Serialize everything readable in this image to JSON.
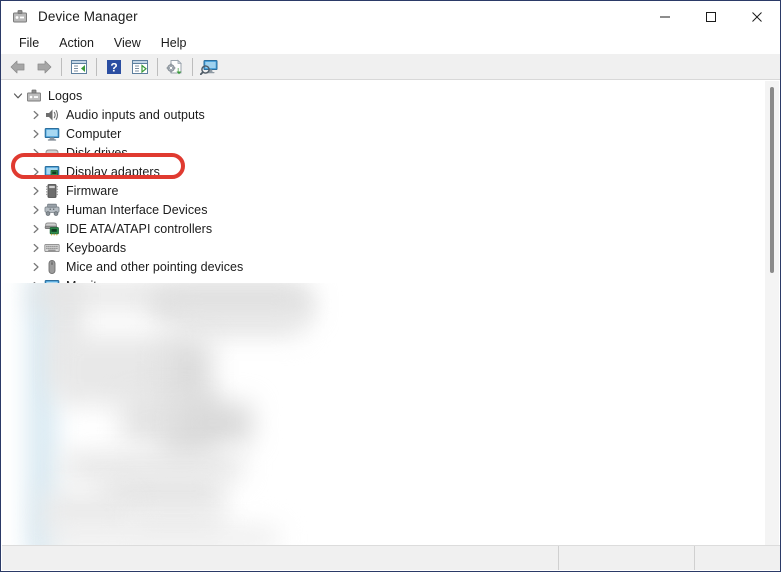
{
  "window": {
    "title": "Device Manager",
    "app_icon": "device-manager-icon",
    "controls": {
      "minimize": "minimize-icon",
      "maximize": "maximize-icon",
      "close": "close-icon"
    }
  },
  "menubar": {
    "items": [
      {
        "label": "File"
      },
      {
        "label": "Action"
      },
      {
        "label": "View"
      },
      {
        "label": "Help"
      }
    ]
  },
  "toolbar": {
    "buttons": [
      {
        "name": "back-arrow-icon",
        "tooltip": "Back",
        "enabled": false
      },
      {
        "name": "forward-arrow-icon",
        "tooltip": "Forward",
        "enabled": false
      },
      {
        "name": "show-hide-console-tree-icon",
        "tooltip": "Show/Hide Console Tree",
        "enabled": true
      },
      {
        "name": "help-icon",
        "tooltip": "Help",
        "enabled": true
      },
      {
        "name": "properties-icon",
        "tooltip": "Properties",
        "enabled": true
      },
      {
        "name": "update-driver-icon",
        "tooltip": "Update driver",
        "enabled": true
      },
      {
        "name": "scan-for-hardware-changes-icon",
        "tooltip": "Scan for hardware changes",
        "enabled": true
      }
    ]
  },
  "tree": {
    "root": {
      "label": "Logos",
      "icon": "computer-root-icon",
      "expanded": true,
      "depth": 0
    },
    "items": [
      {
        "label": "Audio inputs and outputs",
        "icon": "speaker-icon",
        "expanded": false,
        "depth": 1,
        "highlighted": false
      },
      {
        "label": "Computer",
        "icon": "monitor-icon",
        "expanded": false,
        "depth": 1,
        "highlighted": false
      },
      {
        "label": "Disk drives",
        "icon": "disk-drive-icon",
        "expanded": false,
        "depth": 1,
        "highlighted": false
      },
      {
        "label": "Display adapters",
        "icon": "display-adapter-icon",
        "expanded": false,
        "depth": 1,
        "highlighted": true
      },
      {
        "label": "Firmware",
        "icon": "firmware-chip-icon",
        "expanded": false,
        "depth": 1,
        "highlighted": false
      },
      {
        "label": "Human Interface Devices",
        "icon": "hid-icon",
        "expanded": false,
        "depth": 1,
        "highlighted": false
      },
      {
        "label": "IDE ATA/ATAPI controllers",
        "icon": "ide-controller-icon",
        "expanded": false,
        "depth": 1,
        "highlighted": false
      },
      {
        "label": "Keyboards",
        "icon": "keyboard-icon",
        "expanded": false,
        "depth": 1,
        "highlighted": false
      },
      {
        "label": "Mice and other pointing devices",
        "icon": "mouse-icon",
        "expanded": false,
        "depth": 1,
        "highlighted": false
      },
      {
        "label": "Monitors",
        "icon": "monitor-icon",
        "expanded": false,
        "depth": 1,
        "highlighted": false
      }
    ]
  },
  "annotation": {
    "target_label": "Display adapters",
    "shape": "rounded-rectangle",
    "color": "#e03a30"
  },
  "statusbar": {
    "pane1": "",
    "pane2": "",
    "pane3": ""
  },
  "colors": {
    "accent_red": "#e03a30",
    "toolbar_bg": "#f0f0f0",
    "text": "#1b1b1b",
    "chevron": "#767676"
  }
}
